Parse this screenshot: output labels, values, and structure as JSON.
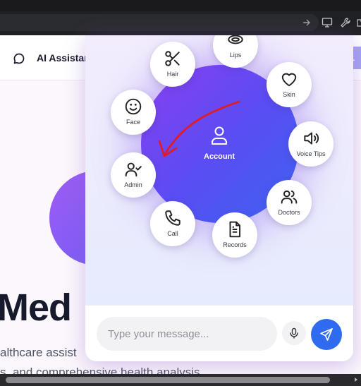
{
  "header": {
    "brand": "AI Assistan",
    "button_label": "L"
  },
  "hero": {
    "title": "Med",
    "subtitle_line1": "althcare assist",
    "subtitle_line2": "s, and comprehensive health analysis"
  },
  "radial_menu": {
    "center": {
      "label": "Account",
      "icon": "user-icon"
    },
    "items": [
      {
        "label": "Hair",
        "icon": "scissors-icon"
      },
      {
        "label": "Lips",
        "icon": "lips-icon"
      },
      {
        "label": "Skin",
        "icon": "heart-icon"
      },
      {
        "label": "Voice Tips",
        "icon": "speaker-icon"
      },
      {
        "label": "Doctors",
        "icon": "users-icon"
      },
      {
        "label": "Records",
        "icon": "file-text-icon"
      },
      {
        "label": "Call",
        "icon": "phone-icon"
      },
      {
        "label": "Admin",
        "icon": "user-check-icon"
      },
      {
        "label": "Face",
        "icon": "smile-icon"
      }
    ]
  },
  "composer": {
    "placeholder": "Type your message..."
  },
  "colors": {
    "accent": "#2f6bf0",
    "blob_start": "#8a3ff0",
    "blob_end": "#3c63ef",
    "annotation_arrow": "#e31b1b"
  }
}
